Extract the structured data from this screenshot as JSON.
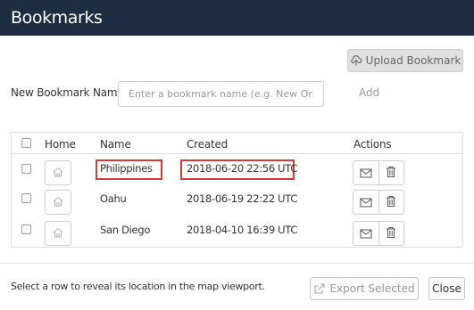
{
  "dialog": {
    "title": "Bookmarks"
  },
  "toolbar": {
    "upload_label": "Upload Bookmark"
  },
  "new_bookmark": {
    "label": "New Bookmark Name:",
    "placeholder": "Enter a bookmark name (e.g. New Orleans)",
    "value": "",
    "add_label": "Add"
  },
  "table": {
    "columns": {
      "home": "Home",
      "name": "Name",
      "created": "Created",
      "actions": "Actions"
    },
    "rows": [
      {
        "name": "Philippines",
        "created": "2018-06-20 22:56 UTC",
        "highlighted": true
      },
      {
        "name": "Oahu",
        "created": "2018-06-19 22:22 UTC",
        "highlighted": false
      },
      {
        "name": "San Diego",
        "created": "2018-04-10 16:39 UTC",
        "highlighted": false
      }
    ]
  },
  "footer": {
    "hint": "Select a row to reveal its location in the map viewport.",
    "export_label": "Export Selected",
    "close_label": "Close"
  },
  "icons": {
    "upload": "upload-icon",
    "home": "home-icon",
    "email": "envelope-icon",
    "delete": "trash-icon",
    "export": "export-icon"
  },
  "colors": {
    "titlebar": "#1d2e42",
    "highlight": "#d33a3a"
  }
}
